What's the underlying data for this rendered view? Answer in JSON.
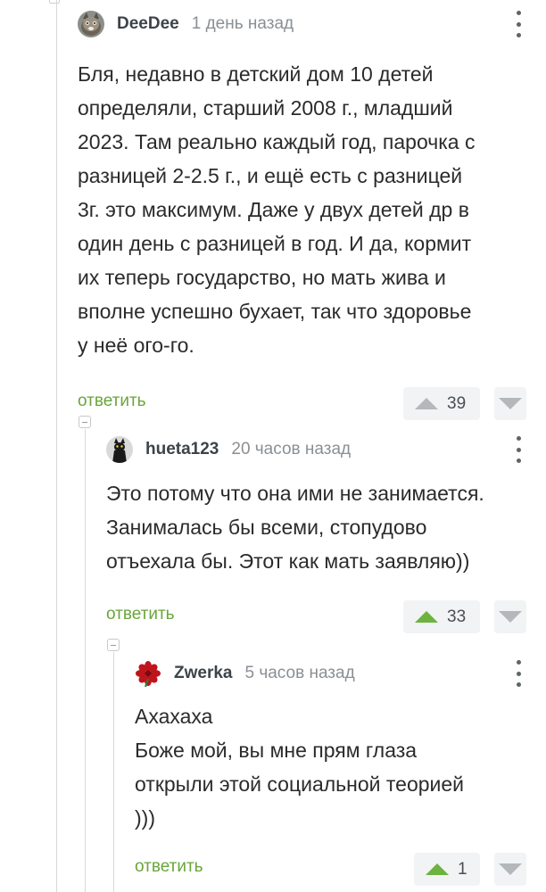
{
  "comments": [
    {
      "author": "DeeDee",
      "time": "1 день назад",
      "lines": [
        "Бля, недавно в детский дом 10 детей",
        "определяли, старший 2008 г., младший",
        "2023. Там реально каждый год, парочка с",
        "разницей 2-2.5 г., и ещё есть с разницей",
        "3г. это максимум. Даже у двух детей др в",
        "один день с разницей в год. И да, кормит",
        "их теперь государство, но мать жива и",
        "вполне успешно бухает, так что здоровье",
        "у неё ого-го."
      ],
      "reply_label": "ответить",
      "score": "39",
      "upvoted": false,
      "avatar_icon": "cat-photo-avatar"
    },
    {
      "author": "hueta123",
      "time": "20 часов назад",
      "lines": [
        "Это потому что она ими не занимается.",
        "Занималась бы всеми, стопудово",
        "отъехала бы. Этот как мать заявляю))"
      ],
      "reply_label": "ответить",
      "score": "33",
      "upvoted": true,
      "avatar_icon": "black-cat-avatar"
    },
    {
      "author": "Zwerka",
      "time": "5 часов назад",
      "lines": [
        "Ахахаха",
        "Боже мой, вы мне прям глаза",
        "открыли этой социальной теорией",
        ")))"
      ],
      "reply_label": "ответить",
      "score": "1",
      "upvoted": true,
      "avatar_icon": "red-flower-avatar"
    }
  ],
  "colors": {
    "reply": "#6aa53a",
    "upvote_active": "#6cb33f",
    "vote_inactive": "#b4b8bb",
    "vote_bg": "#f2f3f4",
    "time": "#8a8f94"
  }
}
